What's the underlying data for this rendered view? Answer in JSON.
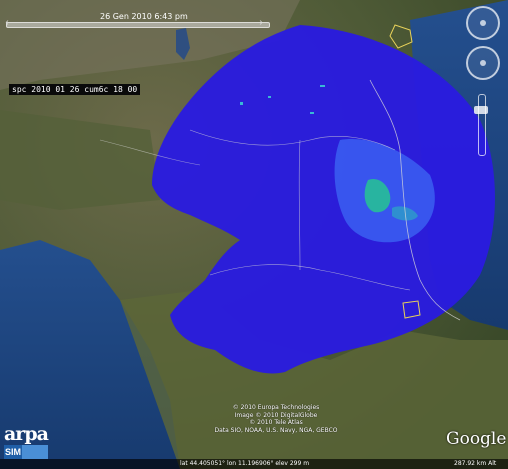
{
  "timeline": {
    "current_time": "26 Gen 2010   6:43 pm",
    "prev_icon": "chevron-left-icon",
    "next_icon": "chevron-right-icon"
  },
  "overlay": {
    "label": "spc 2010 01 26 cum6c 18 00"
  },
  "navigation": {
    "look_icon": "compass-ring-icon",
    "move_icon": "move-ring-icon",
    "zoom_icon": "zoom-slider-icon"
  },
  "logo": {
    "text": "arpa",
    "sub": "SIM"
  },
  "attribution": {
    "lines": [
      "© 2010 Europa Technologies",
      "Image © 2010 DigitalGlobe",
      "© 2010 Tele Atlas",
      "Data SIO, NOAA, U.S. Navy, NGA, GEBCO"
    ]
  },
  "brand": "Google",
  "status": {
    "coords": "lat  44.405051°   lon  11.196906°   elev  299 m",
    "eye_alt": "287.92 km Alt"
  },
  "colors": {
    "radar_low": "#2a1be0",
    "radar_mid": "#3a5cf0",
    "radar_high": "#28b4a0",
    "sea": "#1e4b86",
    "land": "#4b5a34"
  }
}
